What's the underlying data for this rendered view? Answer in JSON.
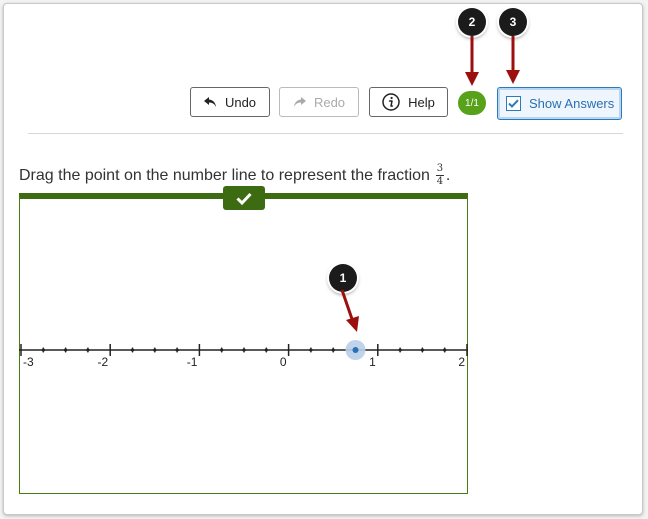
{
  "toolbar": {
    "undo_label": "Undo",
    "redo_label": "Redo",
    "help_label": "Help",
    "score": "1/1",
    "show_answers_label": "Show Answers",
    "show_answers_checked": true
  },
  "question": {
    "prompt": "Drag the point on the number line to represent the fraction",
    "fraction_numerator": "3",
    "fraction_denominator": "4",
    "trailing": "."
  },
  "number_line": {
    "tick_labels": [
      "-3",
      "-2",
      "-1",
      "0",
      "1",
      "2"
    ],
    "min": -3,
    "max": 2,
    "minor_tick_step": 0.25,
    "point_value": 0.75
  },
  "callouts": [
    "1",
    "2",
    "3"
  ],
  "colors": {
    "board_green": "#3d6b12",
    "score_green": "#57a11b",
    "accent_blue": "#2b7abc",
    "callout_arrow": "#9b0f0f",
    "point_blue": "#2a6fb3"
  }
}
